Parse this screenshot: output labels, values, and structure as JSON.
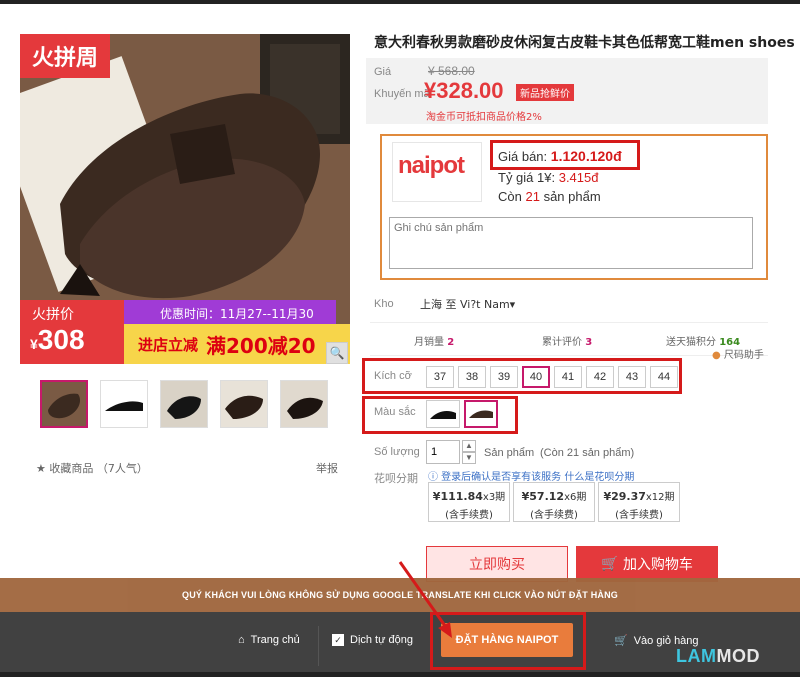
{
  "gallery": {
    "badge": "火拼周",
    "promo_label": "火拼价",
    "promo_price_currency": "¥",
    "promo_price": "308",
    "promo_time": "优惠时间：11月27--11月30",
    "promo_deal_a": "进店立减",
    "promo_deal_b": "满200减20",
    "fav_text": "★ 收藏商品 （7人气）",
    "report": "举报"
  },
  "product": {
    "title": "意大利春秋男款磨砂皮休闲复古皮鞋卡其色低帮宽工鞋men shoes",
    "price_label": "Giá",
    "old_price": "¥ 568.00",
    "promo_label": "Khuyến mãi",
    "promo_price": "¥328.00",
    "new_tag": "新品抢鲜价",
    "taobao_note": "淘金币可抵扣商品价格2%"
  },
  "naipot": {
    "logo": "naipot",
    "gia_ban_label": "Giá bán:",
    "gia_ban_value": "1.120.120đ",
    "ty_gia_label": "Tỷ giá 1¥:",
    "ty_gia_value": "3.415đ",
    "con_label": "Còn",
    "con_value": "21",
    "con_suffix": "sản phẩm",
    "note_placeholder": "Ghi chú sản phẩm"
  },
  "shipping": {
    "kho_label": "Kho",
    "kho_value": "上海  至 Vi?t Nam▾"
  },
  "stats": {
    "sales_label": "月销量",
    "sales_value": "2",
    "reviews_label": "累计评价",
    "reviews_value": "3",
    "points_label": "送天猫积分",
    "points_value": "164",
    "size_helper": "尺码助手"
  },
  "sizes": {
    "label": "Kích cỡ",
    "options": [
      "37",
      "38",
      "39",
      "40",
      "41",
      "42",
      "43",
      "44"
    ],
    "selected": "40"
  },
  "colors": {
    "label": "Màu sắc"
  },
  "quantity": {
    "label": "Số lượng",
    "value": "1",
    "unit": "Sản phẩm",
    "available": "(Còn 21 sản phẩm)",
    "up": "▲",
    "down": "▼"
  },
  "huabei": {
    "label": "花呗分期",
    "note": "ⓘ 登录后确认是否享有该服务 什么是花呗分期",
    "plans": [
      {
        "amount": "¥111.84",
        "term": "x3期",
        "fee": "(含手续费)"
      },
      {
        "amount": "¥57.12",
        "term": "x6期",
        "fee": "(含手续费)"
      },
      {
        "amount": "¥29.37",
        "term": "x12期",
        "fee": "(含手续费)"
      }
    ]
  },
  "actions": {
    "buy_now": "立即购买",
    "add_cart": "加入购物车"
  },
  "overlay": {
    "notice": "QUÝ KHÁCH VUI LÒNG KHÔNG SỬ DỤNG GOOGLE TRANSLATE KHI CLICK VÀO NÚT ĐẶT HÀNG",
    "home": "Trang chủ",
    "auto_translate": "Dịch tự động",
    "order_button": "ĐẶT HÀNG NAIPOT",
    "cart": "Vào giỏ hàng"
  },
  "watermark": {
    "a": "LAM",
    "b": "MOD"
  },
  "colors_theme": {
    "accent": "#e4393c",
    "frame": "#d51a1a",
    "order": "#e97c3c",
    "notice_bg": "#a0673e",
    "bar_bg": "#3b3b3b"
  }
}
